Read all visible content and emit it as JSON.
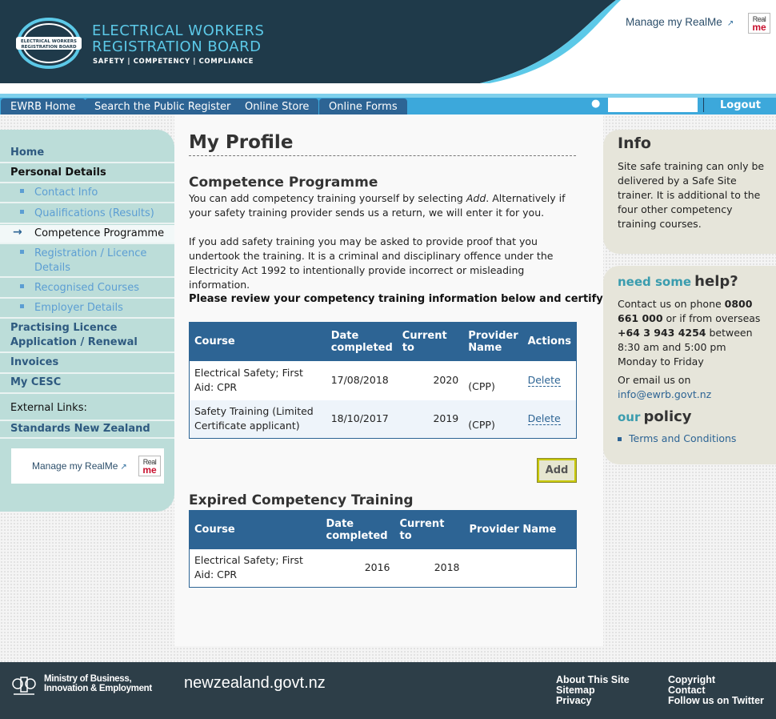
{
  "colors": {
    "header_dark": "#1f3a4a",
    "accent_teal": "#5cc9e8",
    "nav_tab": "#2d6494",
    "sidebar_bg": "#bcddd9",
    "right_box_bg": "#e6e5da",
    "footer_bg": "#2d3e48"
  },
  "header": {
    "org_name_line1": "ELECTRICAL WORKERS",
    "org_name_line2": "REGISTRATION BOARD",
    "tagline": "SAFETY | COMPETENCY | COMPLIANCE",
    "logo_small_line1": "ELECTRICAL WORKERS",
    "logo_small_line2": "REGISTRATION BOARD",
    "realme_link": "Manage my RealMe",
    "realme_badge_top": "Real",
    "realme_badge_bottom": "me"
  },
  "nav": {
    "tabs": [
      "EWRB Home",
      "Search the Public Register",
      "Online Store",
      "Online Forms"
    ],
    "user_value": "",
    "logout": "Logout"
  },
  "sidebar": {
    "home": "Home",
    "personal_details": "Personal Details",
    "contact_info": "Contact Info",
    "qualifications": "Qualifications (Results)",
    "competence_programme": "Competence Programme",
    "registration_line1": "Registration / Licence",
    "registration_line2": "Details",
    "recognised_courses": "Recognised Courses",
    "employer_details": "Employer Details",
    "practising_line1": "Practising Licence",
    "practising_line2": "Application / Renewal",
    "invoices": "Invoices",
    "my_cesc": "My CESC",
    "external_links": "External Links:",
    "standards_nz": "Standards New Zealand",
    "realme_link": "Manage my RealMe"
  },
  "main": {
    "title": "My Profile",
    "section1_heading": "Competence Programme",
    "para1_a": "You can add competency training yourself by selecting ",
    "para1_em": "Add",
    "para1_b": ". Alternatively if your safety training provider sends us a return, we will enter it for you.",
    "para2": "If you add safety training you may be asked to provide proof that you undertook the training. It is a criminal and disciplinary offence under the Electricity Act 1992 to intentionally provide incorrect or misleading information.",
    "review_text": "Please review your competency training information below and certify:",
    "current_table": {
      "headers": [
        "Course",
        "Date completed",
        "Current to",
        "Provider Name",
        "Actions"
      ],
      "rows": [
        {
          "course": "Electrical Safety; First Aid: CPR",
          "date": "17/08/2018",
          "current_to": "2020",
          "provider": "(CPP)",
          "action": "Delete"
        },
        {
          "course": "Safety Training (Limited Certificate applicant)",
          "date": "18/10/2017",
          "current_to": "2019",
          "provider": "(CPP)",
          "action": "Delete"
        }
      ]
    },
    "add_button": "Add",
    "section2_heading": "Expired Competency Training",
    "expired_table": {
      "headers": [
        "Course",
        "Date completed",
        "Current to",
        "Provider Name"
      ],
      "rows": [
        {
          "course": "Electrical Safety; First Aid: CPR",
          "date": "2016",
          "current_to": "2018",
          "provider": ""
        }
      ]
    }
  },
  "right": {
    "info_title": "Info",
    "info_text": "Site safe training can only be delivered by a Safe Site trainer. It is additional to the four other competency training courses.",
    "help_pre": "need some",
    "help_big": "help?",
    "help_text_1": "Contact us on phone ",
    "help_phone": "0800 661 000",
    "help_text_2": " or if from overseas ",
    "help_phone_intl": "+64 3 943 4254",
    "help_text_3": " between 8:30 am and 5:00 pm Monday to Friday",
    "email_label": "Or email us on",
    "email": "info@ewrb.govt.nz",
    "policy_pre": "our",
    "policy_big": "policy",
    "terms": "Terms and Conditions"
  },
  "footer": {
    "mbie_line1": "Ministry of Business,",
    "mbie_line2": "Innovation & Employment",
    "nzgovt": "newzealand.govt.nz",
    "about": "About This Site",
    "sitemap": "Sitemap",
    "privacy": "Privacy",
    "copyright": "Copyright",
    "contact": "Contact",
    "twitter": "Follow us on Twitter"
  }
}
